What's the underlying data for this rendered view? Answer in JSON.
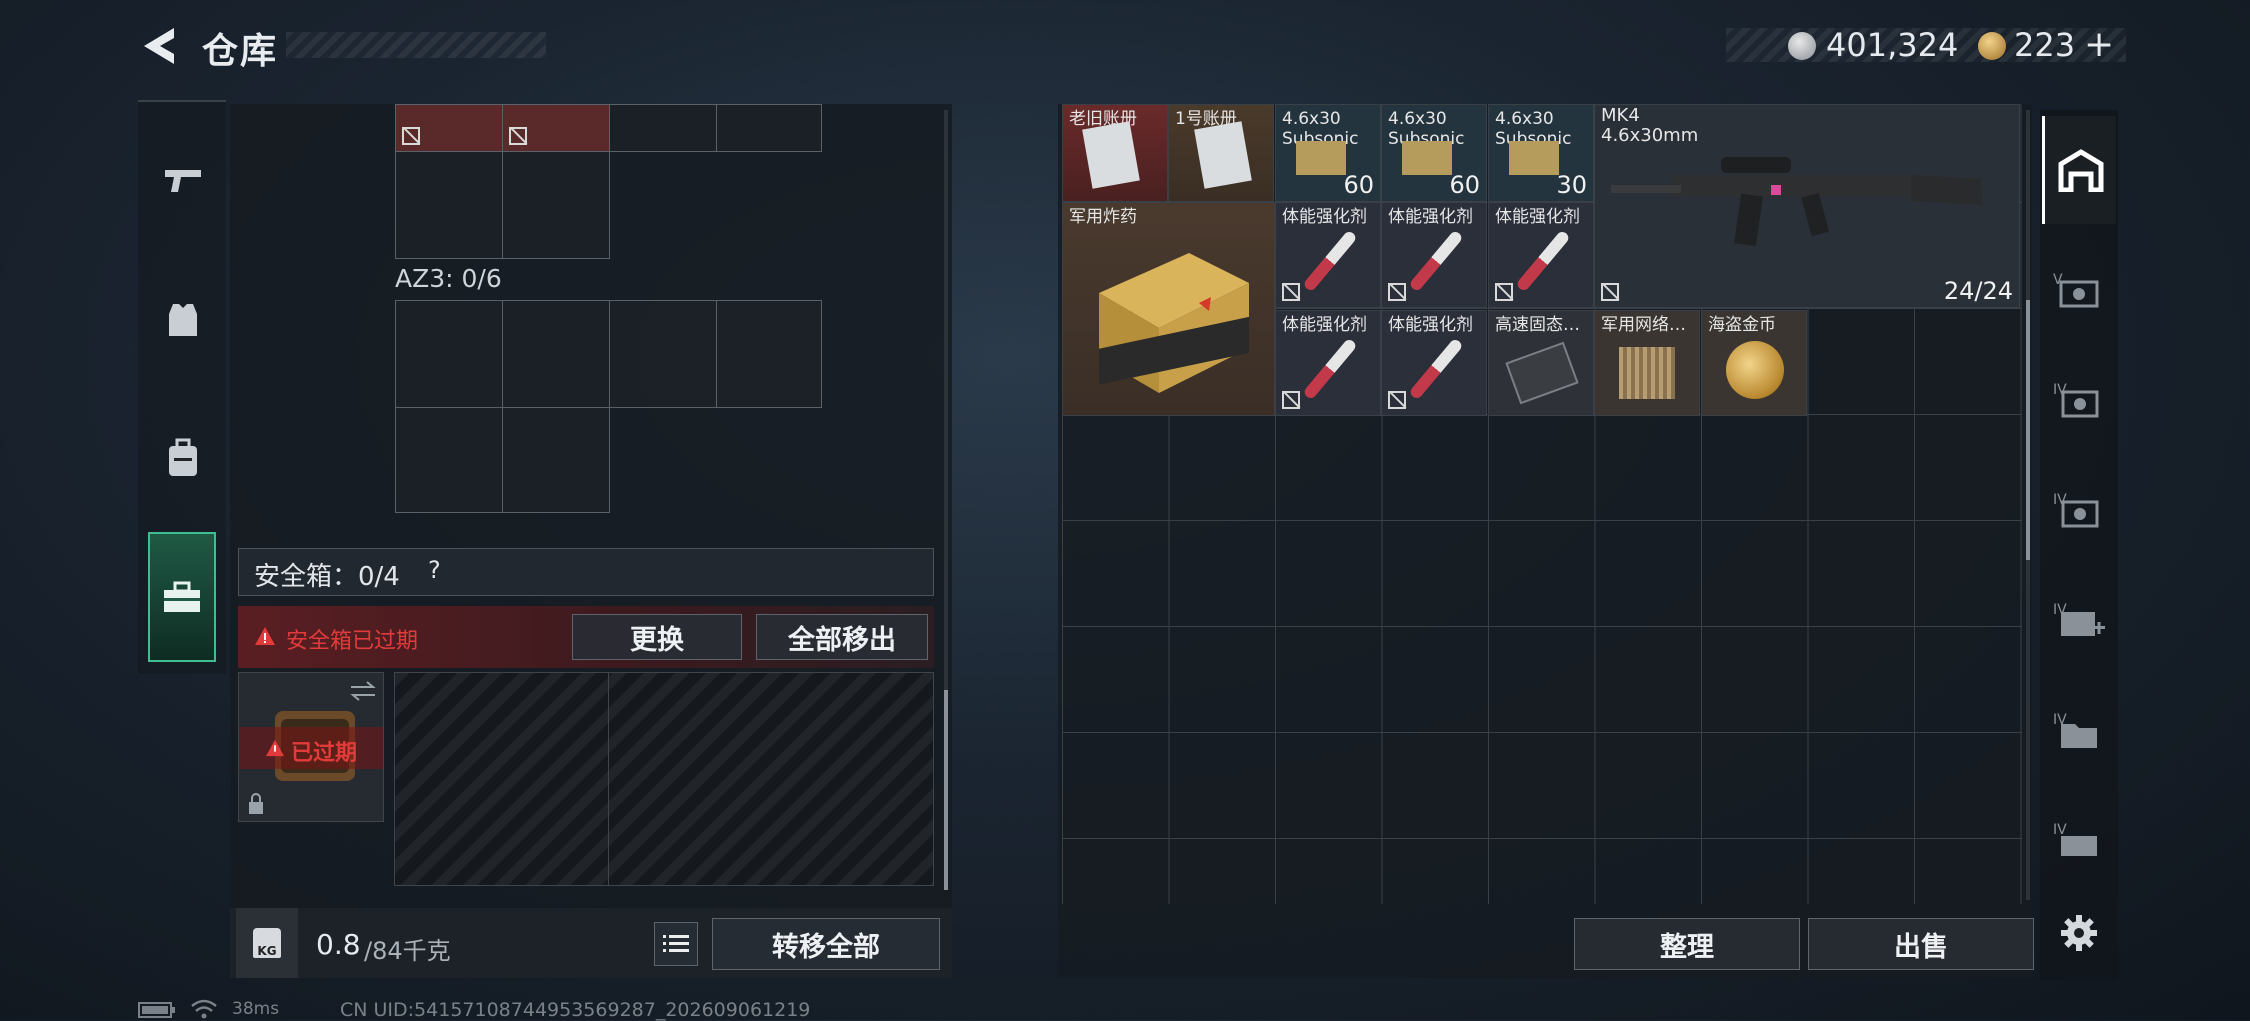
{
  "header": {
    "title": "仓库",
    "silver": "401,324",
    "gold": "223",
    "gold_plus": "+"
  },
  "left_tabs": [
    "gun-icon",
    "vest-icon",
    "backpack-icon",
    "toolbox-icon"
  ],
  "container": {
    "az3_label": "AZ3: 0/6",
    "safebox_label": "安全箱：0/4",
    "help": "?",
    "expired_warning": "安全箱已过期",
    "replace_button": "更换",
    "remove_all_button": "全部移出",
    "case_expired_badge": "已过期",
    "weight_value": "0.8",
    "weight_total": "/84千克",
    "weight_badge": "KG",
    "transfer_all_button": "转移全部"
  },
  "stash": {
    "items": {
      "row1": [
        {
          "label": "老旧账册",
          "bg": "red"
        },
        {
          "label": "1号账册",
          "bg": "brown"
        },
        {
          "label": "4.6x30 Subsonic",
          "count": "60"
        },
        {
          "label": "4.6x30 Subsonic",
          "count": "60"
        },
        {
          "label": "4.6x30 Subsonic",
          "count": "30"
        }
      ],
      "weapon": {
        "name": "MK4",
        "caliber": "4.6x30mm",
        "ammo": "24/24"
      },
      "explosive": {
        "label": "军用炸药"
      },
      "stim": "体能强化剂",
      "ssd": "高速固态…",
      "network": "军用网络…",
      "coin": "海盗金币"
    },
    "sort_button": "整理",
    "sell_button": "出售"
  },
  "status_bar": {
    "ping": "38ms",
    "uid": "CN UID:54157108744953569287_202609061219"
  },
  "colors": {
    "red_warning": "#e23b3b",
    "gold": "#c9a15a",
    "panel": "#161b21"
  }
}
